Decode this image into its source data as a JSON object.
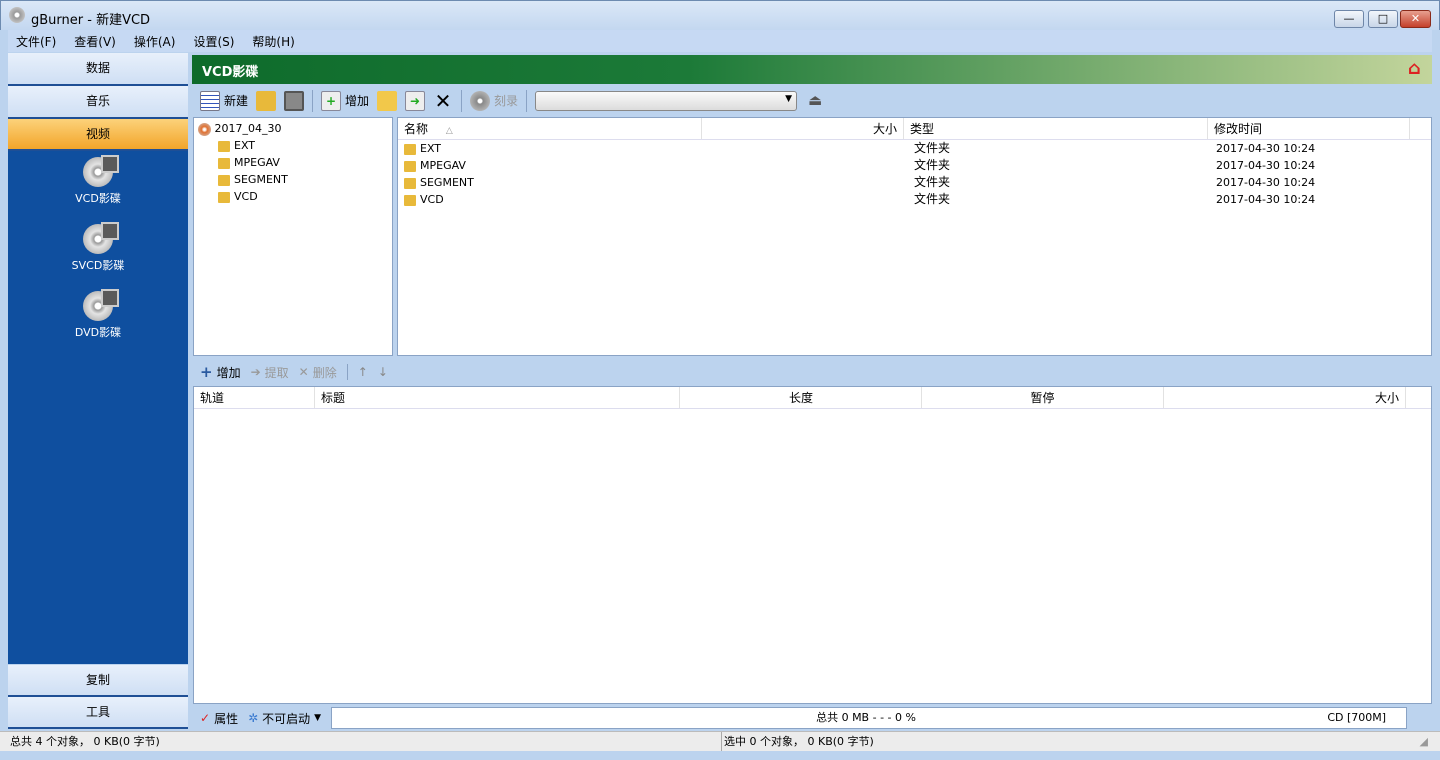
{
  "window": {
    "title": "gBurner - 新建VCD",
    "min": "—",
    "max": "□",
    "close": "✕"
  },
  "menu": [
    "文件(F)",
    "查看(V)",
    "操作(A)",
    "设置(S)",
    "帮助(H)"
  ],
  "sidebar": {
    "top": [
      "数据",
      "音乐",
      "视频"
    ],
    "items": [
      "VCD影碟",
      "SVCD影碟",
      "DVD影碟"
    ],
    "bottom": [
      "复制",
      "工具"
    ]
  },
  "header": {
    "title": "VCD影碟"
  },
  "toolbar": {
    "new": "新建",
    "add": "增加",
    "burn": "刻录",
    "drive_value": ""
  },
  "tree": {
    "root": "2017_04_30",
    "children": [
      "EXT",
      "MPEGAV",
      "SEGMENT",
      "VCD"
    ]
  },
  "files": {
    "columns": [
      "名称",
      "大小",
      "类型",
      "修改时间"
    ],
    "sort_indicator": "△",
    "rows": [
      {
        "name": "EXT",
        "size": "",
        "type": "文件夹",
        "modified": "2017-04-30 10:24"
      },
      {
        "name": "MPEGAV",
        "size": "",
        "type": "文件夹",
        "modified": "2017-04-30 10:24"
      },
      {
        "name": "SEGMENT",
        "size": "",
        "type": "文件夹",
        "modified": "2017-04-30 10:24"
      },
      {
        "name": "VCD",
        "size": "",
        "type": "文件夹",
        "modified": "2017-04-30 10:24"
      }
    ]
  },
  "tracks": {
    "toolbar": {
      "add": "增加",
      "extract": "提取",
      "delete": "删除"
    },
    "columns": [
      "轨道",
      "标题",
      "长度",
      "暂停",
      "大小"
    ]
  },
  "bottom": {
    "properties": "属性",
    "boot": "不可启动",
    "total": "总共  0 MB   - - -  0 %",
    "capacity": "CD [700M]"
  },
  "status": {
    "left": "总共 4 个对象， 0 KB(0 字节)",
    "right": "选中 0 个对象， 0 KB(0 字节)"
  }
}
